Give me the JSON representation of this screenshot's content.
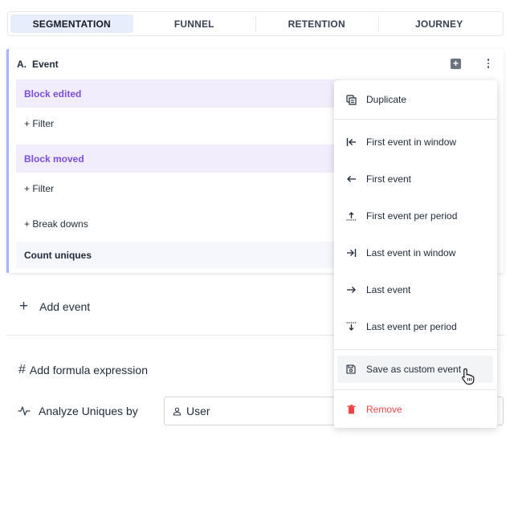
{
  "tabs": [
    "SEGMENTATION",
    "FUNNEL",
    "RETENTION",
    "JOURNEY"
  ],
  "active_tab": "SEGMENTATION",
  "event_card": {
    "letter": "A.",
    "title": "Event",
    "blocks": [
      {
        "name": "Block edited",
        "filter": "+ Filter"
      },
      {
        "name": "Block moved",
        "filter": "+ Filter"
      }
    ],
    "breakdowns": "+ Break downs",
    "count": "Count uniques"
  },
  "add_event": "Add event",
  "add_formula": "Add formula expression",
  "analyze": {
    "label": "Analyze Uniques by",
    "value": "User"
  },
  "menu": {
    "duplicate": "Duplicate",
    "first_in_window": "First event in window",
    "first": "First event",
    "first_per_period": "First event per period",
    "last_in_window": "Last event in window",
    "last": "Last event",
    "last_per_period": "Last event per period",
    "save_custom": "Save as custom event",
    "remove": "Remove"
  },
  "colors": {
    "accent": "#7c4ddb",
    "block_bg": "#f1edfd",
    "active_tab_bg": "#e8edfb",
    "danger": "#ef4444"
  }
}
